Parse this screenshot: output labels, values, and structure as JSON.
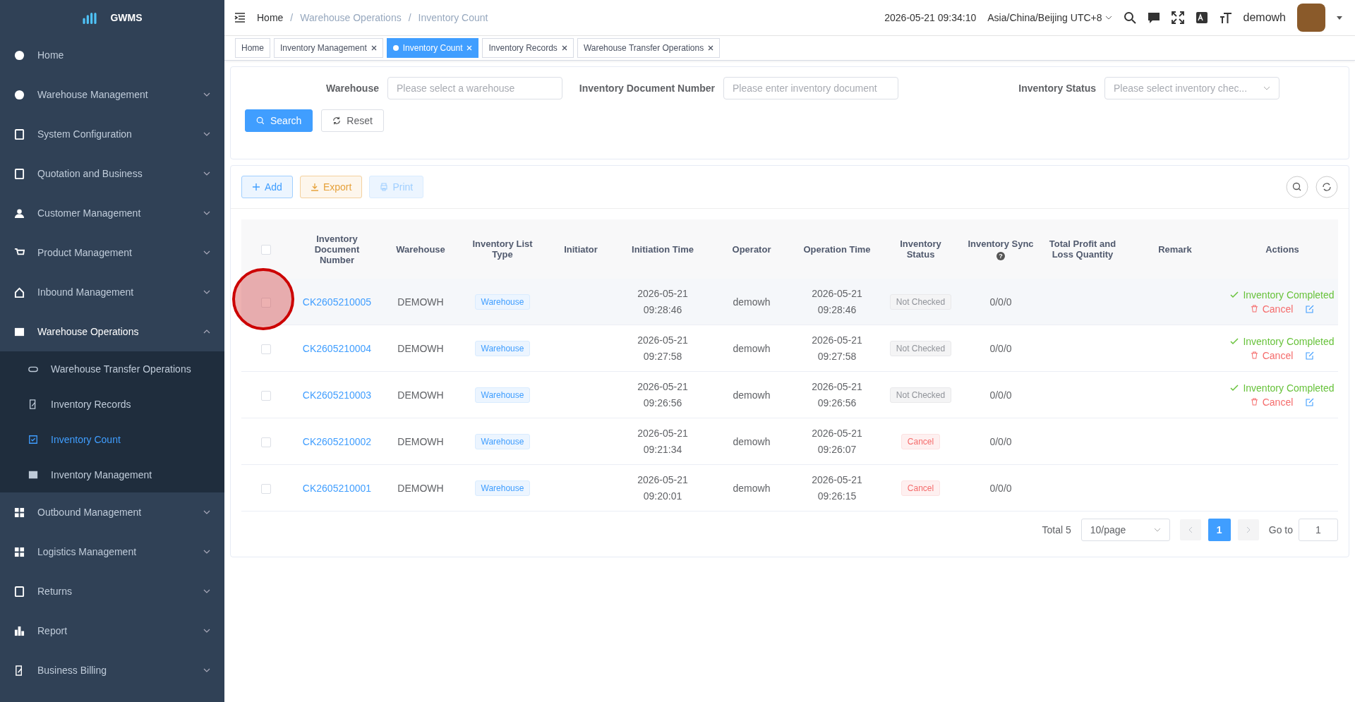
{
  "sidebar": {
    "logo": "GWMS",
    "items": [
      {
        "label": "Home",
        "expandable": false,
        "expanded": false
      },
      {
        "label": "Warehouse Management",
        "expandable": true,
        "expanded": false
      },
      {
        "label": "System Configuration",
        "expandable": true,
        "expanded": false
      },
      {
        "label": "Quotation and Business",
        "expandable": true,
        "expanded": false
      },
      {
        "label": "Customer Management",
        "expandable": true,
        "expanded": false
      },
      {
        "label": "Product Management",
        "expandable": true,
        "expanded": false
      },
      {
        "label": "Inbound Management",
        "expandable": true,
        "expanded": false
      },
      {
        "label": "Warehouse Operations",
        "expandable": true,
        "expanded": true,
        "children": [
          {
            "label": "Warehouse Transfer Operations",
            "selected": false
          },
          {
            "label": "Inventory Records",
            "selected": false
          },
          {
            "label": "Inventory Count",
            "selected": true
          },
          {
            "label": "Inventory Management",
            "selected": false
          }
        ]
      },
      {
        "label": "Outbound Management",
        "expandable": true,
        "expanded": false
      },
      {
        "label": "Logistics Management",
        "expandable": true,
        "expanded": false
      },
      {
        "label": "Returns",
        "expandable": true,
        "expanded": false
      },
      {
        "label": "Report",
        "expandable": true,
        "expanded": false
      },
      {
        "label": "Business Billing",
        "expandable": true,
        "expanded": false
      }
    ]
  },
  "header": {
    "breadcrumb": [
      "Home",
      "Warehouse Operations",
      "Inventory Count"
    ],
    "separator": "/",
    "datetime": "2026-05-21 09:34:10",
    "timezone": "Asia/China/Beijing UTC+8",
    "user": "demowh"
  },
  "tabs": [
    {
      "label": "Home",
      "selected": false,
      "closable": false
    },
    {
      "label": "Inventory Management",
      "selected": false,
      "closable": true
    },
    {
      "label": "Inventory Count",
      "selected": true,
      "closable": true
    },
    {
      "label": "Inventory Records",
      "selected": false,
      "closable": true
    },
    {
      "label": "Warehouse Transfer Operations",
      "selected": false,
      "closable": true
    }
  ],
  "filters": [
    {
      "label": "Warehouse",
      "placeholder": "Please select a warehouse",
      "kind": "input"
    },
    {
      "label": "Inventory Document Number",
      "placeholder": "Please enter inventory document",
      "kind": "input"
    },
    {
      "label": "Inventory Status",
      "placeholder": "Please select inventory chec...",
      "kind": "select"
    }
  ],
  "search_button": "Search",
  "reset_button": "Reset",
  "toolbar": [
    {
      "label": "Add",
      "kind": "add",
      "disabled": false
    },
    {
      "label": "Export",
      "kind": "export",
      "disabled": false
    },
    {
      "label": "Print",
      "kind": "print",
      "disabled": true
    }
  ],
  "table": {
    "columns": [
      "Inventory Document Number",
      "Warehouse",
      "Inventory List Type",
      "Initiator",
      "Initiation Time",
      "Operator",
      "Operation Time",
      "Inventory Status",
      "Inventory Sync",
      "Total Profit and Loss Quantity",
      "Remark",
      "Actions"
    ],
    "sync_help": "?",
    "all_checked": false,
    "rows": [
      {
        "checked": false,
        "hovered": true,
        "number": "CK2605210005",
        "warehouse": "DEMOWH",
        "type": "Warehouse",
        "initiation_date": "2026-05-21",
        "initiation_time": "09:28:46",
        "operator": "demowh",
        "operation_date": "2026-05-21",
        "operation_time": "09:28:46",
        "status": {
          "label": "Not Checked",
          "kind": "neutral"
        },
        "sync": "0/0/0",
        "actions": [
          "Inventory Completed",
          "Cancel"
        ]
      },
      {
        "checked": false,
        "hovered": false,
        "number": "CK2605210004",
        "warehouse": "DEMOWH",
        "type": "Warehouse",
        "initiation_date": "2026-05-21",
        "initiation_time": "09:27:58",
        "operator": "demowh",
        "operation_date": "2026-05-21",
        "operation_time": "09:27:58",
        "status": {
          "label": "Not Checked",
          "kind": "neutral"
        },
        "sync": "0/0/0",
        "actions": [
          "Inventory Completed",
          "Cancel"
        ]
      },
      {
        "checked": false,
        "hovered": false,
        "number": "CK2605210003",
        "warehouse": "DEMOWH",
        "type": "Warehouse",
        "initiation_date": "2026-05-21",
        "initiation_time": "09:26:56",
        "operator": "demowh",
        "operation_date": "2026-05-21",
        "operation_time": "09:26:56",
        "status": {
          "label": "Not Checked",
          "kind": "neutral"
        },
        "sync": "0/0/0",
        "actions": [
          "Inventory Completed",
          "Cancel"
        ]
      },
      {
        "checked": false,
        "hovered": false,
        "number": "CK2605210002",
        "warehouse": "DEMOWH",
        "type": "Warehouse",
        "initiation_date": "2026-05-21",
        "initiation_time": "09:21:34",
        "operator": "demowh",
        "operation_date": "2026-05-21",
        "operation_time": "09:26:07",
        "status": {
          "label": "Cancel",
          "kind": "danger"
        },
        "sync": "0/0/0"
      },
      {
        "checked": false,
        "hovered": false,
        "number": "CK2605210001",
        "warehouse": "DEMOWH",
        "type": "Warehouse",
        "initiation_date": "2026-05-21",
        "initiation_time": "09:20:01",
        "operator": "demowh",
        "operation_date": "2026-05-21",
        "operation_time": "09:26:15",
        "status": {
          "label": "Cancel",
          "kind": "danger"
        },
        "sync": "0/0/0"
      }
    ]
  },
  "pagination": {
    "total": "Total 5",
    "page_size": "10/page",
    "pages": [
      {
        "label": "1",
        "selected": true
      }
    ],
    "goto_label": "Go to",
    "goto_value": "1"
  }
}
